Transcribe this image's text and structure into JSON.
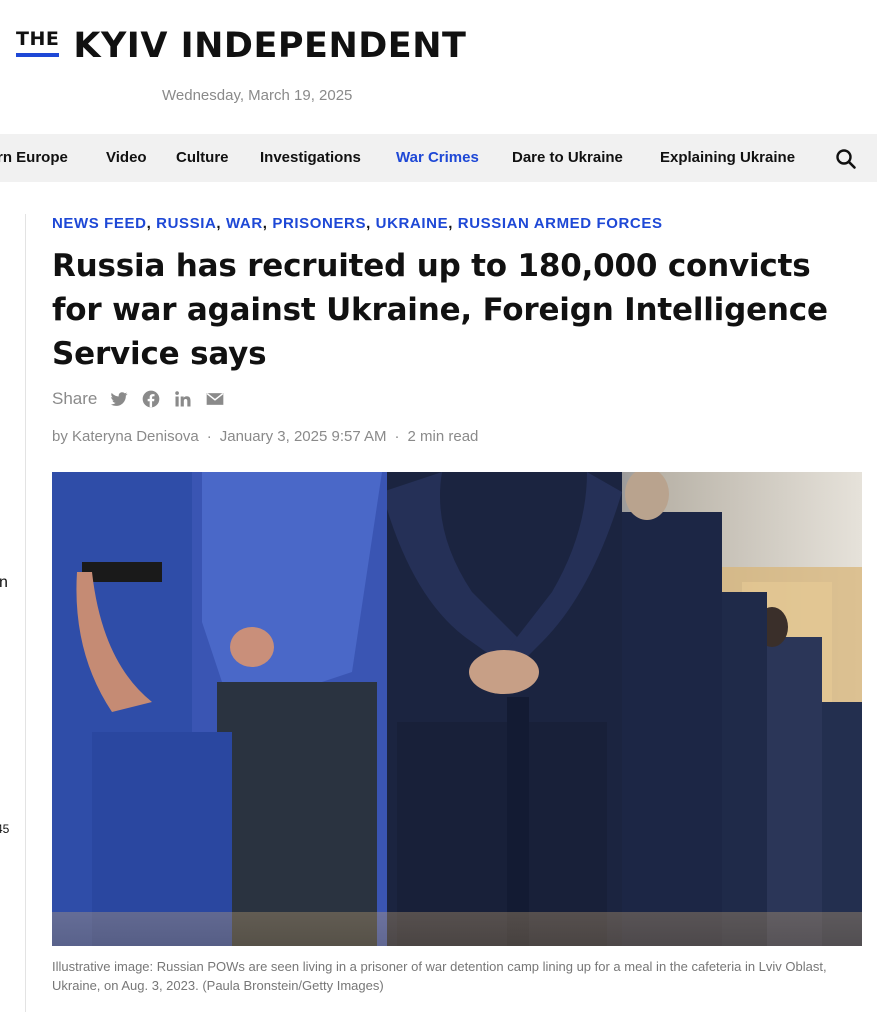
{
  "site": {
    "logo_prefix": "THE",
    "logo_name": "KYIV INDEPENDENT",
    "date": "Wednesday, March 19, 2025"
  },
  "nav": {
    "items": [
      {
        "label": "rn Europe"
      },
      {
        "label": "Video"
      },
      {
        "label": "Culture"
      },
      {
        "label": "Investigations"
      },
      {
        "label": "War Crimes",
        "active": true
      },
      {
        "label": "Dare to Ukraine"
      },
      {
        "label": "Explaining Ukraine"
      }
    ],
    "search_icon": "search-icon"
  },
  "left_rail": {
    "frag1": "n",
    "frag2": "45"
  },
  "article": {
    "tags": [
      "NEWS FEED",
      "RUSSIA",
      "WAR",
      "PRISONERS",
      "UKRAINE",
      "RUSSIAN ARMED FORCES"
    ],
    "tag_separator": ",",
    "headline": "Russia has recruited up to 180,000 convicts for war against Ukraine, Foreign Intelligence Service says",
    "share_label": "Share",
    "share_icons": [
      "twitter-icon",
      "facebook-icon",
      "linkedin-icon",
      "email-icon"
    ],
    "byline": {
      "author": "by Kateryna Denisova",
      "datetime": "January 3, 2025 9:57 AM",
      "read_time": "2 min read",
      "separator": "·"
    },
    "caption": "Illustrative image: Russian POWs are seen living in a prisoner of war detention camp lining up for a meal in the cafeteria in Lviv Oblast, Ukraine, on Aug. 3, 2023. (Paula Bronstein/Getty Images)"
  },
  "colors": {
    "accent": "#1e48d6",
    "text": "#111111",
    "muted": "#8a8a8a",
    "nav_bg": "#f1f1f1"
  }
}
